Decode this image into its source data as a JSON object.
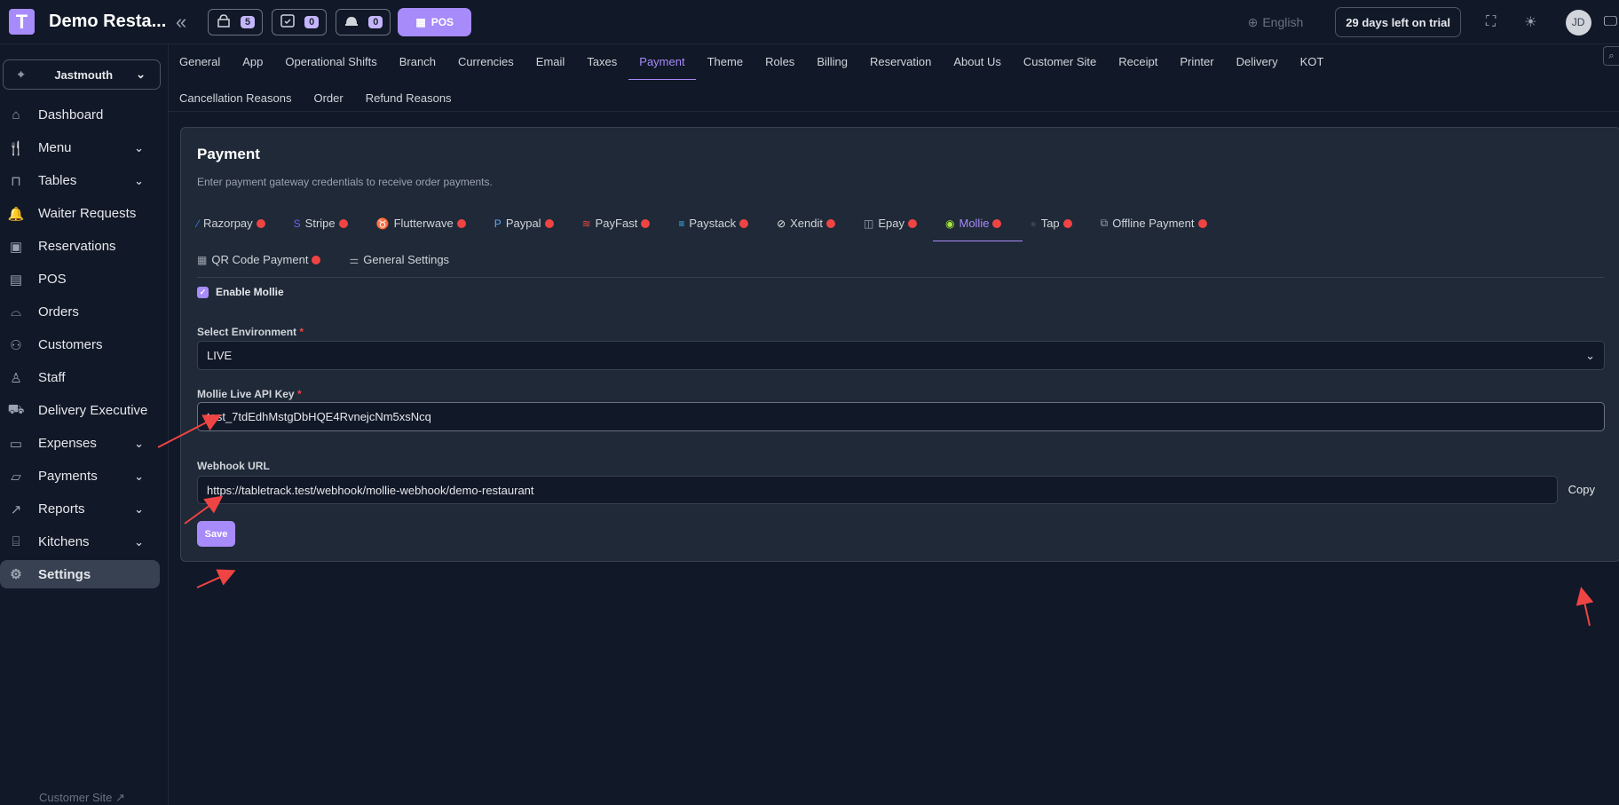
{
  "topbar": {
    "logo_letter": "T",
    "brand": "Demo Resta...",
    "collapse_icon": "double-chevron-left-icon",
    "chips": [
      {
        "icon": "kitchen-icon",
        "count": "5"
      },
      {
        "icon": "calendar-check-icon",
        "count": "0"
      },
      {
        "icon": "bell-icon",
        "count": "0"
      }
    ],
    "pos_label": "POS",
    "language": "English",
    "trial": "29 days left on trial",
    "avatar": "JD"
  },
  "sidebar": {
    "branch": "Jastmouth",
    "items": [
      {
        "label": "Dashboard",
        "icon": "home-icon",
        "expandable": false
      },
      {
        "label": "Menu",
        "icon": "menu-icon",
        "expandable": true
      },
      {
        "label": "Tables",
        "icon": "table-icon",
        "expandable": true
      },
      {
        "label": "Waiter Requests",
        "icon": "bell-icon",
        "expandable": false
      },
      {
        "label": "Reservations",
        "icon": "calendar-icon",
        "expandable": false
      },
      {
        "label": "POS",
        "icon": "pos-icon",
        "expandable": false
      },
      {
        "label": "Orders",
        "icon": "cloche-icon",
        "expandable": false
      },
      {
        "label": "Customers",
        "icon": "users-icon",
        "expandable": false
      },
      {
        "label": "Staff",
        "icon": "staff-icon",
        "expandable": false
      },
      {
        "label": "Delivery Executive",
        "icon": "scooter-icon",
        "expandable": false
      },
      {
        "label": "Expenses",
        "icon": "wallet-icon",
        "expandable": true
      },
      {
        "label": "Payments",
        "icon": "payments-icon",
        "expandable": true
      },
      {
        "label": "Reports",
        "icon": "chart-icon",
        "expandable": true
      },
      {
        "label": "Kitchens",
        "icon": "kitchen-icon",
        "expandable": true
      },
      {
        "label": "Settings",
        "icon": "gear-icon",
        "expandable": false,
        "active": true
      }
    ],
    "customer_site": "Customer Site"
  },
  "settings_tabs": {
    "row1": [
      "General",
      "App",
      "Operational Shifts",
      "Branch",
      "Currencies",
      "Email",
      "Taxes",
      "Payment",
      "Theme",
      "Roles",
      "Billing",
      "Reservation",
      "About Us",
      "Customer Site",
      "Receipt",
      "Printer",
      "Delivery",
      "KOT"
    ],
    "row2": [
      "Cancellation Reasons",
      "Order",
      "Refund Reasons"
    ],
    "active": "Payment"
  },
  "payment": {
    "title": "Payment",
    "description": "Enter payment gateway credentials to receive order payments.",
    "gateways_row1": [
      {
        "label": "Razorpay",
        "icon": "razorpay-icon",
        "color": "#3b82f6",
        "status_dot": true
      },
      {
        "label": "Stripe",
        "icon": "stripe-icon",
        "color": "#6366f1",
        "status_dot": true
      },
      {
        "label": "Flutterwave",
        "icon": "flutterwave-icon",
        "color": "#f59e0b",
        "status_dot": true
      },
      {
        "label": "Paypal",
        "icon": "paypal-icon",
        "color": "#60a5fa",
        "status_dot": true
      },
      {
        "label": "PayFast",
        "icon": "payfast-icon",
        "color": "#ef4444",
        "status_dot": true
      },
      {
        "label": "Paystack",
        "icon": "paystack-icon",
        "color": "#38bdf8",
        "status_dot": true
      },
      {
        "label": "Xendit",
        "icon": "xendit-icon",
        "color": "#e5e7eb",
        "status_dot": true
      },
      {
        "label": "Epay",
        "icon": "epay-icon",
        "color": "#9ca3af",
        "status_dot": true
      },
      {
        "label": "Mollie",
        "icon": "mollie-icon",
        "color": "#a3e635",
        "status_dot": true,
        "active": true
      },
      {
        "label": "Tap",
        "icon": "tap-icon",
        "color": "#374151",
        "status_dot": true
      },
      {
        "label": "Offline Payment",
        "icon": "offline-payment-icon",
        "color": "#9ca3af",
        "status_dot": true
      }
    ],
    "gateways_row2": [
      {
        "label": "QR Code Payment",
        "icon": "qr-code-icon",
        "color": "#9ca3af",
        "status_dot": true
      },
      {
        "label": "General Settings",
        "icon": "sliders-icon",
        "color": "#9ca3af",
        "status_dot": false
      }
    ],
    "enable_label": "Enable Mollie",
    "enabled": true,
    "environment_label": "Select Environment",
    "environment_value": "LIVE",
    "api_key_label": "Mollie Live API Key",
    "api_key_value": "test_7tdEdhMstgDbHQE4RvnejcNm5xsNcq",
    "webhook_label": "Webhook URL",
    "webhook_value": "https://tabletrack.test/webhook/mollie-webhook/demo-restaurant",
    "copy_label": "Copy",
    "save_label": "Save",
    "required_mark": "*"
  },
  "colors": {
    "accent": "#a78bfa",
    "annotation_arrow": "#ef4444",
    "status_dot": "#ef4444"
  }
}
